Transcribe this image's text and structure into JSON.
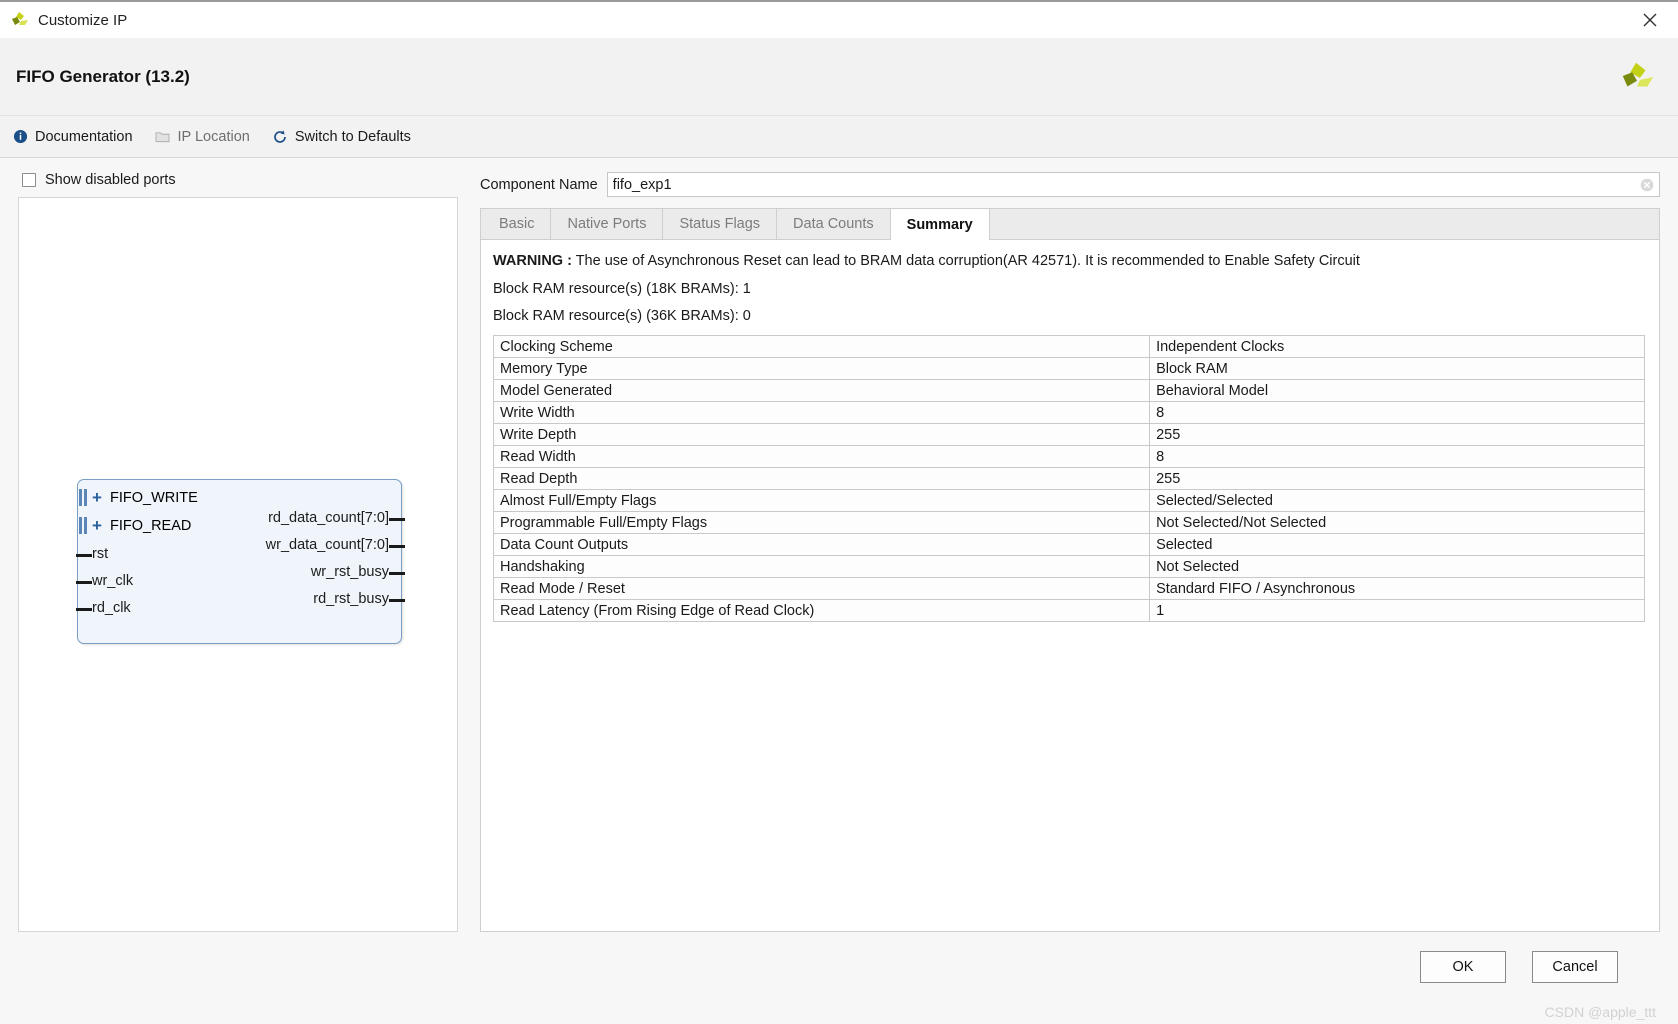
{
  "window": {
    "title": "Customize IP",
    "close_icon": "close-icon",
    "app_icon": "xilinx-logo-icon"
  },
  "header": {
    "title": "FIFO Generator (13.2)",
    "logo_icon": "xilinx-logo-icon"
  },
  "toolbar": {
    "items": [
      {
        "label": "Documentation",
        "icon": "info-icon",
        "disabled": false
      },
      {
        "label": "IP Location",
        "icon": "folder-icon",
        "disabled": true
      },
      {
        "label": "Switch to Defaults",
        "icon": "refresh-icon",
        "disabled": false
      }
    ]
  },
  "left_panel": {
    "show_disabled_ports_label": "Show disabled ports",
    "show_disabled_ports_checked": false,
    "symbol": {
      "bus_ports": [
        "FIFO_WRITE",
        "FIFO_READ"
      ],
      "input_ports": [
        "rst",
        "wr_clk",
        "rd_clk"
      ],
      "output_ports": [
        "rd_data_count[7:0]",
        "wr_data_count[7:0]",
        "wr_rst_busy",
        "rd_rst_busy"
      ]
    }
  },
  "component_name": {
    "label": "Component Name",
    "value": "fifo_exp1",
    "placeholder": "Component Name",
    "clear_icon": "clear-circle-icon"
  },
  "tabs": [
    {
      "label": "Basic",
      "active": false
    },
    {
      "label": "Native Ports",
      "active": false
    },
    {
      "label": "Status Flags",
      "active": false
    },
    {
      "label": "Data Counts",
      "active": false
    },
    {
      "label": "Summary",
      "active": true
    }
  ],
  "summary": {
    "warning_prefix": "WARNING :",
    "warning_text": " The use of Asynchronous Reset can lead to BRAM data corruption(AR 42571). It is recommended to Enable Safety Circuit",
    "resources": [
      "Block RAM resource(s) (18K BRAMs): 1",
      "Block RAM resource(s) (36K BRAMs): 0"
    ],
    "rows": [
      {
        "key": "Clocking Scheme",
        "value": "Independent Clocks"
      },
      {
        "key": "Memory Type",
        "value": "Block RAM"
      },
      {
        "key": "Model Generated",
        "value": "Behavioral Model"
      },
      {
        "key": "Write Width",
        "value": "8"
      },
      {
        "key": "Write Depth",
        "value": "255"
      },
      {
        "key": "Read Width",
        "value": "8"
      },
      {
        "key": "Read Depth",
        "value": "255"
      },
      {
        "key": "Almost Full/Empty Flags",
        "value": "Selected/Selected"
      },
      {
        "key": "Programmable Full/Empty Flags",
        "value": "Not Selected/Not Selected"
      },
      {
        "key": "Data Count Outputs",
        "value": "Selected"
      },
      {
        "key": "Handshaking",
        "value": "Not Selected"
      },
      {
        "key": "Read Mode / Reset",
        "value": "Standard FIFO / Asynchronous"
      },
      {
        "key": "Read Latency (From Rising Edge of Read Clock)",
        "value": "1"
      }
    ]
  },
  "footer": {
    "ok_label": "OK",
    "cancel_label": "Cancel",
    "watermark": "CSDN @apple_ttt"
  },
  "colors": {
    "accent": "#2a5f9e",
    "symbol_fill": "#f0f5fb",
    "symbol_border": "#7b9fc4",
    "xilinx_green": "#c3d117",
    "xilinx_dark": "#7a8a0e"
  }
}
